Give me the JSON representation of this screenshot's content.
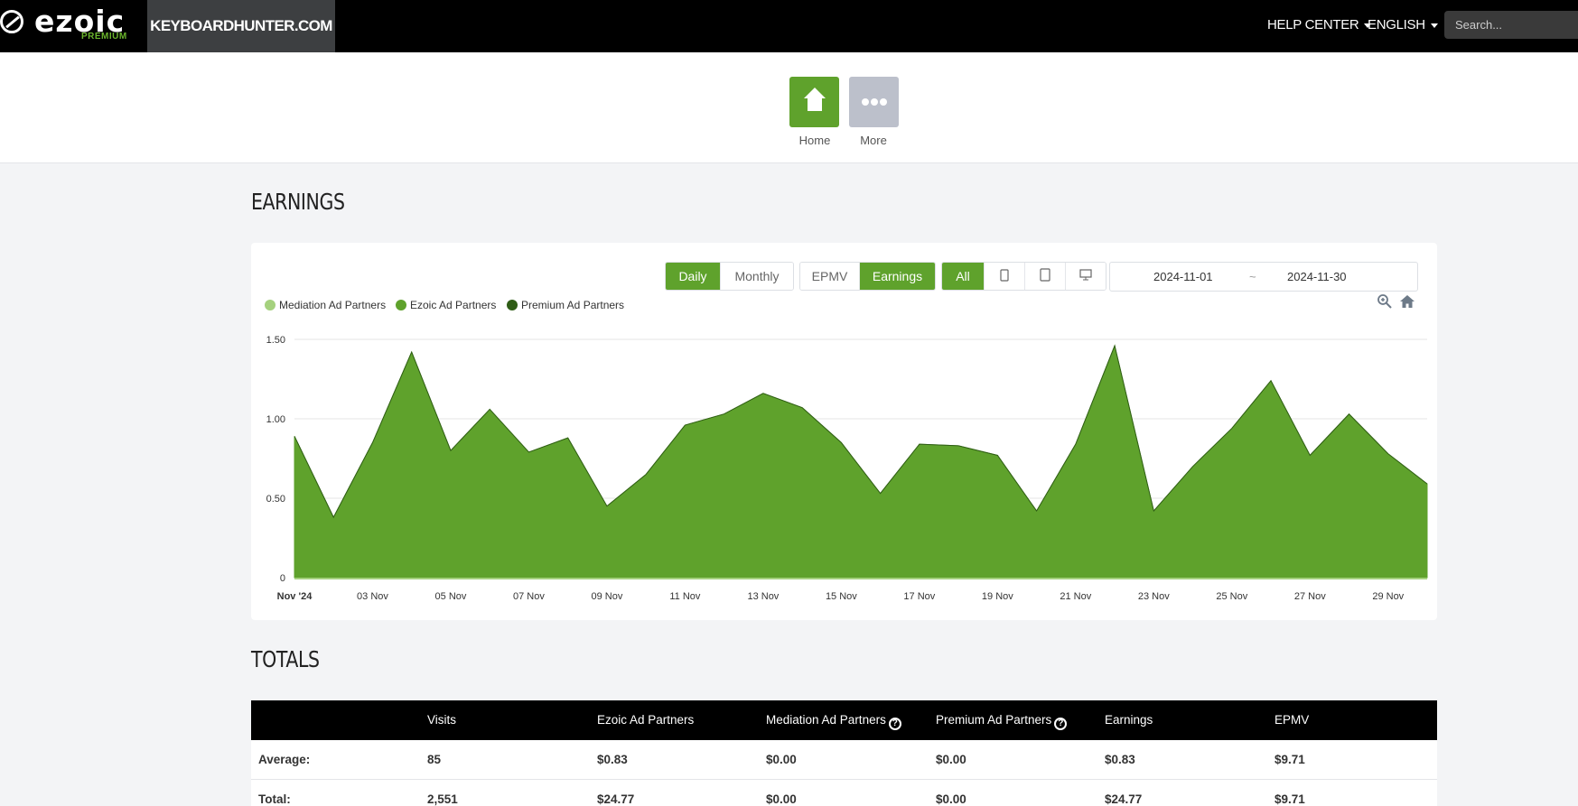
{
  "brand": {
    "logo_text": "ezoic",
    "tier": "PREMIUM"
  },
  "site": {
    "name": "KEYBOARDHUNTER.COM"
  },
  "nav": {
    "help_center": "HELP CENTER",
    "language": "ENGLISH",
    "search_placeholder": "Search..."
  },
  "quicknav": {
    "home_label": "Home",
    "more_label": "More"
  },
  "earnings": {
    "title": "EARNINGS",
    "period_buttons": [
      "Daily",
      "Monthly"
    ],
    "period_active": "Daily",
    "metric_buttons": [
      "EPMV",
      "Earnings"
    ],
    "metric_active": "Earnings",
    "device_all": "All",
    "device_icons": [
      "phone-icon",
      "tablet-icon",
      "desktop-icon"
    ],
    "date_start": "2024-11-01",
    "date_sep": "~",
    "date_end": "2024-11-30",
    "colors": {
      "accent": "#5fa22c",
      "mediation": "#a5d17e",
      "ezoic": "#5fa22c",
      "premium": "#2f5d16"
    }
  },
  "chart_data": {
    "type": "area",
    "title": "",
    "xlabel": "",
    "ylabel": "",
    "legend": [
      "Mediation Ad Partners",
      "Ezoic Ad Partners",
      "Premium Ad Partners"
    ],
    "legend_position": "top-left",
    "ylim": [
      0,
      1.5
    ],
    "yticks": [
      "0",
      "0.50",
      "1.00",
      "1.50"
    ],
    "x_tick_labels": [
      "Nov '24",
      "03 Nov",
      "05 Nov",
      "07 Nov",
      "09 Nov",
      "11 Nov",
      "13 Nov",
      "15 Nov",
      "17 Nov",
      "19 Nov",
      "21 Nov",
      "23 Nov",
      "25 Nov",
      "27 Nov",
      "29 Nov"
    ],
    "x": [
      "2024-11-01",
      "2024-11-02",
      "2024-11-03",
      "2024-11-04",
      "2024-11-05",
      "2024-11-06",
      "2024-11-07",
      "2024-11-08",
      "2024-11-09",
      "2024-11-10",
      "2024-11-11",
      "2024-11-12",
      "2024-11-13",
      "2024-11-14",
      "2024-11-15",
      "2024-11-16",
      "2024-11-17",
      "2024-11-18",
      "2024-11-19",
      "2024-11-20",
      "2024-11-21",
      "2024-11-22",
      "2024-11-23",
      "2024-11-24",
      "2024-11-25",
      "2024-11-26",
      "2024-11-27",
      "2024-11-28",
      "2024-11-29",
      "2024-11-30"
    ],
    "grid": true,
    "series": [
      {
        "name": "Mediation Ad Partners",
        "values": [
          0,
          0,
          0,
          0,
          0,
          0,
          0,
          0,
          0,
          0,
          0,
          0,
          0,
          0,
          0,
          0,
          0,
          0,
          0,
          0,
          0,
          0,
          0,
          0,
          0,
          0,
          0,
          0,
          0,
          0
        ]
      },
      {
        "name": "Ezoic Ad Partners",
        "values": [
          0.89,
          0.38,
          0.85,
          1.42,
          0.8,
          1.06,
          0.79,
          0.88,
          0.45,
          0.65,
          0.96,
          1.03,
          1.16,
          1.07,
          0.85,
          0.53,
          0.84,
          0.83,
          0.77,
          0.42,
          0.84,
          1.46,
          0.42,
          0.7,
          0.94,
          1.24,
          0.77,
          1.03,
          0.78,
          0.59
        ]
      },
      {
        "name": "Premium Ad Partners",
        "values": [
          0,
          0,
          0,
          0,
          0,
          0,
          0,
          0,
          0,
          0,
          0,
          0,
          0,
          0,
          0,
          0,
          0,
          0,
          0,
          0,
          0,
          0,
          0,
          0,
          0,
          0,
          0,
          0,
          0,
          0
        ]
      }
    ]
  },
  "totals": {
    "title": "TOTALS",
    "columns": [
      "",
      "Visits",
      "Ezoic Ad Partners",
      "Mediation Ad Partners",
      "Premium Ad Partners",
      "Earnings",
      "EPMV"
    ],
    "help_mark": "?",
    "rows": [
      {
        "label": "Average:",
        "cells": [
          "85",
          "$0.83",
          "$0.00",
          "$0.00",
          "$0.83",
          "$9.71"
        ]
      },
      {
        "label": "Total:",
        "cells": [
          "2,551",
          "$24.77",
          "$0.00",
          "$0.00",
          "$24.77",
          "$9.71"
        ]
      }
    ]
  }
}
